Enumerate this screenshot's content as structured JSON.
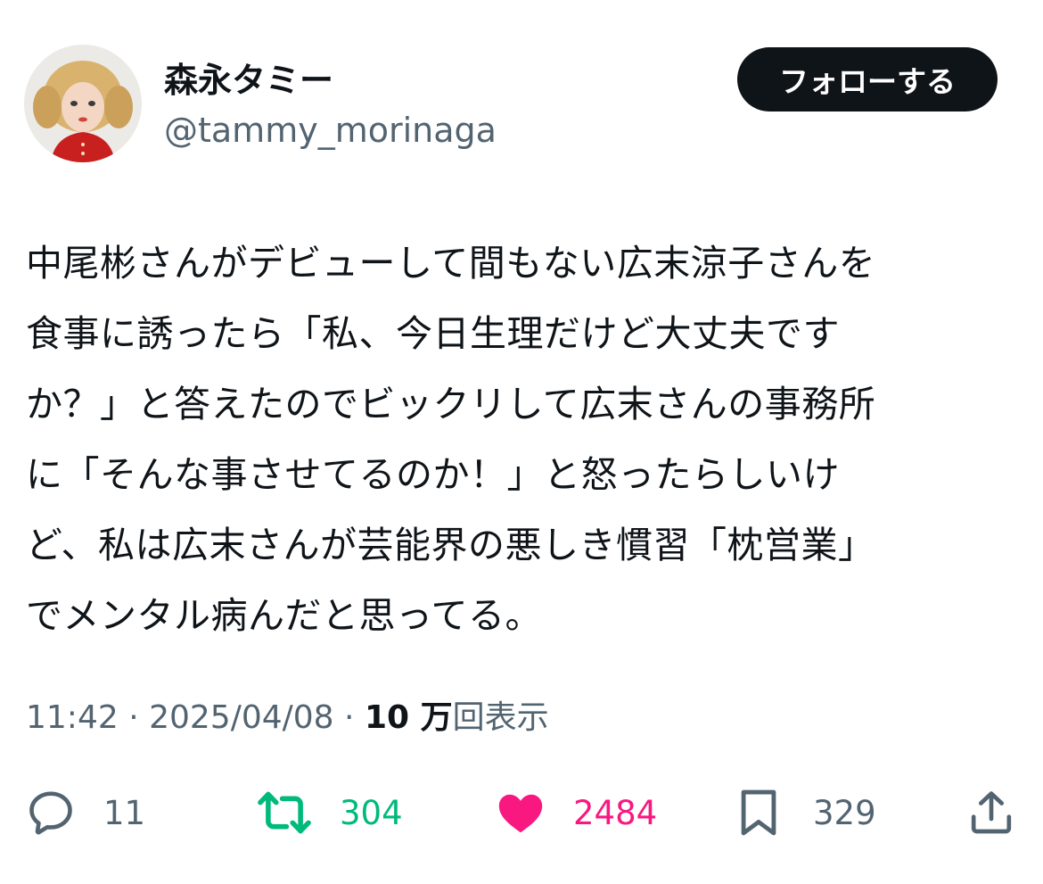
{
  "author": {
    "display_name": "森永タミー",
    "handle": "@tammy_morinaga"
  },
  "follow_button": {
    "label": "フォローする"
  },
  "tweet": {
    "lines": [
      "中尾彬さんがデビューして間もない広末涼子さんを",
      "食事に誘ったら「私、今日生理だけど大丈夫です",
      "か？」と答えたのでビックリして広末さんの事務所",
      "に「そんな事させてるのか！」と怒ったらしいけ",
      "ど、私は広末さんが芸能界の悪しき慣習「枕営業」",
      "でメンタル病んだと思ってる。"
    ]
  },
  "meta": {
    "time": "11:42",
    "separator": " · ",
    "date": "2025/04/08",
    "views_count": "10 万",
    "views_label": "回表示"
  },
  "actions": {
    "replies": "11",
    "retweets": "304",
    "likes": "2484",
    "bookmarks": "329"
  },
  "colors": {
    "text": "#0f1419",
    "secondary": "#536471",
    "retweet": "#00ba7c",
    "like": "#f91880",
    "follow_bg": "#0f1419"
  },
  "icons": {
    "reply": "speech-bubble-icon",
    "retweet": "retweet-arrows-icon",
    "like": "heart-icon-filled",
    "bookmark": "bookmark-icon",
    "share": "share-upload-icon"
  }
}
